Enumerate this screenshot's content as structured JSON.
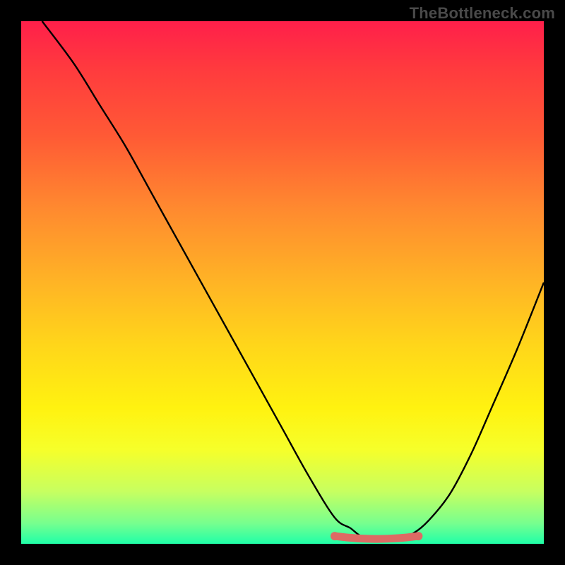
{
  "watermark": "TheBottleneck.com",
  "chart_data": {
    "type": "line",
    "title": "",
    "xlabel": "",
    "ylabel": "",
    "xlim": [
      0,
      100
    ],
    "ylim": [
      0,
      1
    ],
    "grid": false,
    "series": [
      {
        "name": "curve",
        "x": [
          4,
          10,
          15,
          20,
          25,
          30,
          35,
          40,
          45,
          50,
          55,
          60,
          63,
          65,
          68,
          72,
          75,
          78,
          82,
          86,
          90,
          95,
          100
        ],
        "y": [
          1.0,
          0.92,
          0.84,
          0.76,
          0.67,
          0.58,
          0.49,
          0.4,
          0.31,
          0.22,
          0.13,
          0.05,
          0.03,
          0.015,
          0.008,
          0.01,
          0.02,
          0.045,
          0.095,
          0.17,
          0.26,
          0.375,
          0.5
        ]
      }
    ],
    "annotations": [
      {
        "name": "flat-min-highlight",
        "x_start": 60,
        "x_end": 76,
        "y": 0.012,
        "color": "#de6a64"
      }
    ],
    "background_gradient": {
      "stops": [
        {
          "pos": 0.0,
          "color": "#ff1f4a"
        },
        {
          "pos": 0.5,
          "color": "#ffd61a"
        },
        {
          "pos": 0.82,
          "color": "#f6ff2a"
        },
        {
          "pos": 1.0,
          "color": "#1fffa8"
        }
      ]
    }
  },
  "plot": {
    "pixel_size": 740
  }
}
